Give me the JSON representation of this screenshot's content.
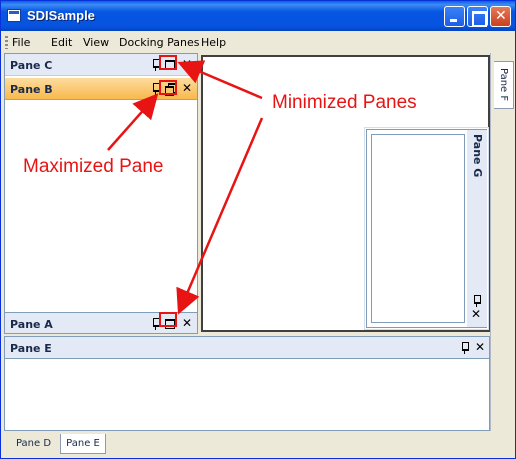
{
  "window": {
    "title": "SDISample",
    "accent": "#0653df"
  },
  "menu": {
    "items": [
      "File",
      "Edit",
      "View",
      "Docking Panes",
      "Help"
    ]
  },
  "panes": {
    "c": {
      "title": "Pane C",
      "icons": [
        "pin-icon",
        "maximize-icon",
        "close-icon"
      ]
    },
    "b": {
      "title": "Pane B",
      "icons": [
        "pin-icon",
        "restore-icon",
        "close-icon"
      ],
      "active_color": "#f9b94c"
    },
    "a": {
      "title": "Pane A",
      "icons": [
        "pin-icon",
        "maximize-icon",
        "close-icon"
      ]
    },
    "g": {
      "title": "Pane G"
    },
    "f": {
      "title": "Pane F"
    },
    "e": {
      "title": "Pane E"
    }
  },
  "bottom_tabs": [
    "Pane D",
    "Pane E"
  ],
  "annotations": {
    "minimized": "Minimized Panes",
    "maximized": "Maximized Pane",
    "color": "#e81414"
  }
}
